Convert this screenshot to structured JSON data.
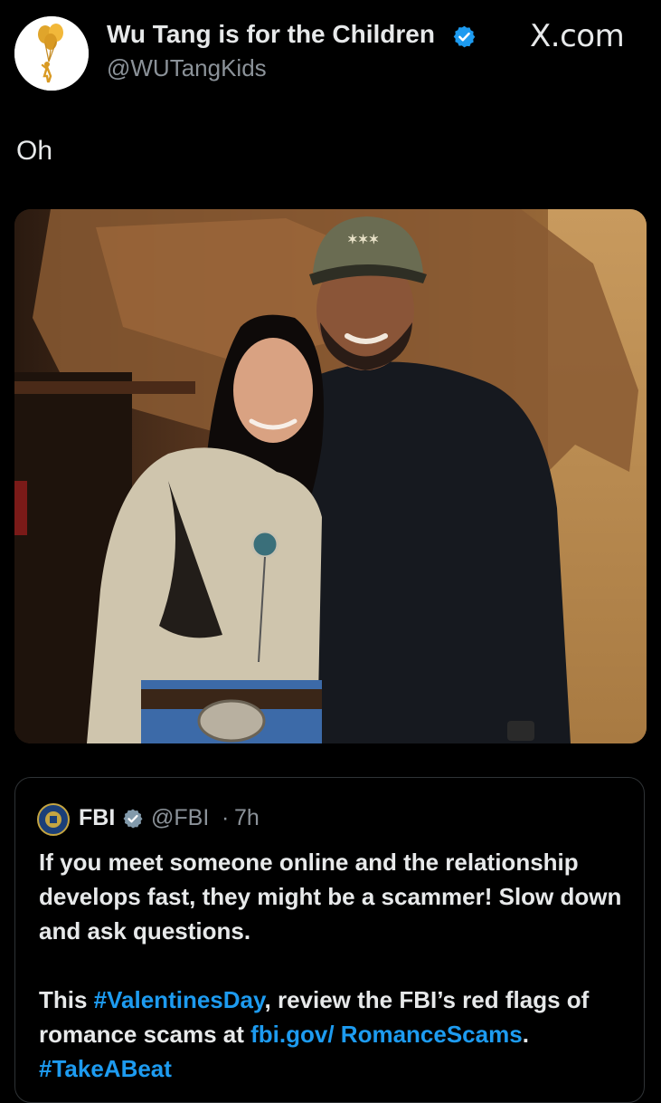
{
  "header": {
    "display_name": "Wu Tang is for the Children",
    "handle": "@WUTangKids",
    "watermark": "X.com"
  },
  "tweet": {
    "text": "Oh"
  },
  "quote": {
    "name": "FBI",
    "handle": "@FBI",
    "separator": "·",
    "time": "7h",
    "line1": "If you meet someone online and the relationship develops fast, they might be a scammer! Slow down and ask questions.",
    "line2_before": "This ",
    "hashtag1": "#ValentinesDay",
    "line2_middle": ", review the FBI’s red flags of romance scams at ",
    "link": "fbi.gov/ RomanceScams",
    "line2_after": ". ",
    "hashtag2": "#TakeABeat"
  },
  "colors": {
    "background": "#000000",
    "text": "#e7e9ea",
    "muted": "#8b9299",
    "link": "#1d9bf0",
    "verified": "#1d9bf0"
  },
  "icons": {
    "avatar": "golden-balloon-child-logo",
    "verified": "verified-badge-icon",
    "fbi_avatar": "fbi-seal-icon"
  }
}
